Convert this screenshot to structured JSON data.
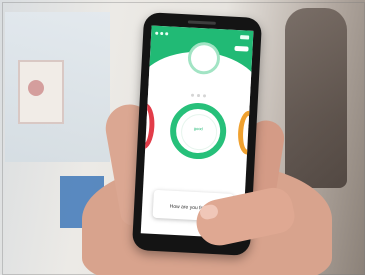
{
  "screen": {
    "accent_color": "#21ba75",
    "alert_color": "#e23c49",
    "warning_color": "#f0a12f",
    "header": {
      "menu_icon": "menu-icon",
      "avatar_icon": "avatar-icon"
    },
    "ring": {
      "label": "good",
      "icon": "mood-ring-icon"
    },
    "prompt": {
      "kicker": "",
      "question": "How are you feeling?"
    }
  }
}
